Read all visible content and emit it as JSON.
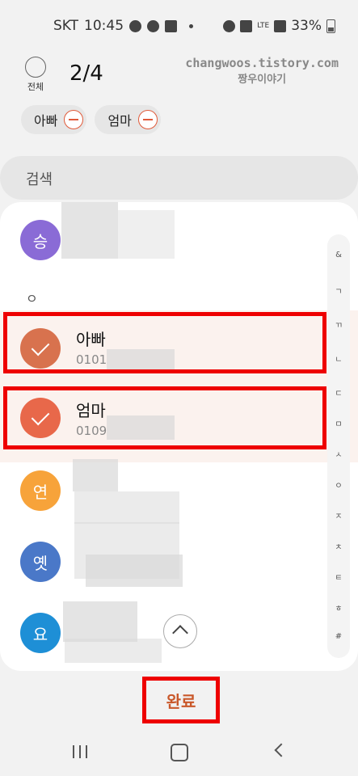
{
  "status_bar": {
    "carrier": "SKT",
    "time": "10:45",
    "network": "LTE",
    "battery": "33%"
  },
  "header": {
    "select_all_label": "전체",
    "selected_count": "2/4",
    "watermark_line1": "changwoos.tistory.com",
    "watermark_line2": "짱우이야기"
  },
  "chips": [
    {
      "label": "아빠"
    },
    {
      "label": "엄마"
    }
  ],
  "search": {
    "placeholder": "검색"
  },
  "contacts": [
    {
      "avatar": "승",
      "color": "#8a6bd6",
      "name": "",
      "phone": "",
      "checked": false
    },
    {
      "avatar": "",
      "color": "#d8724e",
      "name": "아빠",
      "phone": "0101",
      "checked": true
    },
    {
      "avatar": "",
      "color": "#e8684a",
      "name": "엄마",
      "phone": "0109",
      "checked": true
    },
    {
      "avatar": "연",
      "color": "#f7a33a",
      "name": "",
      "phone": "",
      "checked": false
    },
    {
      "avatar": "옛",
      "color": "#4a78c8",
      "name": "",
      "phone": "",
      "checked": false
    },
    {
      "avatar": "요",
      "color": "#1e8fd6",
      "name": "",
      "phone": "",
      "checked": false
    }
  ],
  "group_label": "ㅇ",
  "index_letters": [
    "&",
    "ㄱ",
    "ㄲ",
    "ㄴ",
    "ㄷ",
    "ㅁ",
    "ㅅ",
    "ㅇ",
    "ㅈ",
    "ㅊ",
    "ㅌ",
    "ㅎ",
    "#"
  ],
  "done_label": "완료"
}
